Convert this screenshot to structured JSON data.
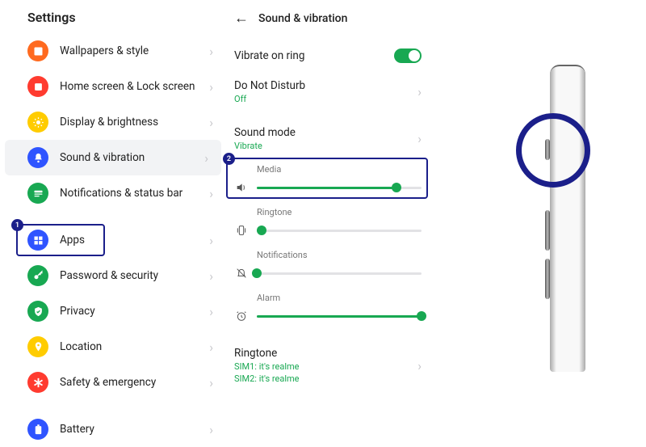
{
  "left": {
    "title": "Settings",
    "items": [
      {
        "label": "Wallpapers & style",
        "icon": "wallpaper",
        "color": "#ff6a1f"
      },
      {
        "label": "Home screen & Lock screen",
        "icon": "home",
        "color": "#ff3b2f"
      },
      {
        "label": "Display & brightness",
        "icon": "sun",
        "color": "#ffcc00"
      },
      {
        "label": "Sound & vibration",
        "icon": "bell",
        "color": "#2f54ff",
        "selected": true
      },
      {
        "label": "Notifications & status bar",
        "icon": "notif",
        "color": "#18a852"
      },
      {
        "label": "Apps",
        "icon": "grid",
        "color": "#2f54ff",
        "annotated": 1
      },
      {
        "label": "Password & security",
        "icon": "key",
        "color": "#18a852"
      },
      {
        "label": "Privacy",
        "icon": "shield",
        "color": "#18a852"
      },
      {
        "label": "Location",
        "icon": "pin",
        "color": "#ffcc00"
      },
      {
        "label": "Safety & emergency",
        "icon": "asterisk",
        "color": "#ff3b2f"
      },
      {
        "label": "Battery",
        "icon": "battery",
        "color": "#2f54ff"
      }
    ]
  },
  "mid": {
    "title": "Sound & vibration",
    "vibrate_label": "Vibrate on ring",
    "dnd_label": "Do Not Disturb",
    "dnd_sub": "Off",
    "mode_label": "Sound mode",
    "mode_sub": "Vibrate",
    "sliders": {
      "media": {
        "label": "Media",
        "value": 85
      },
      "ringtone": {
        "label": "Ringtone",
        "value": 3
      },
      "notifications": {
        "label": "Notifications",
        "value": 0
      },
      "alarm": {
        "label": "Alarm",
        "value": 100
      }
    },
    "ringtone_row": {
      "label": "Ringtone",
      "sub1": "SIM1: it's realme",
      "sub2": "SIM2: it's realme"
    },
    "media_annotated": 2
  }
}
